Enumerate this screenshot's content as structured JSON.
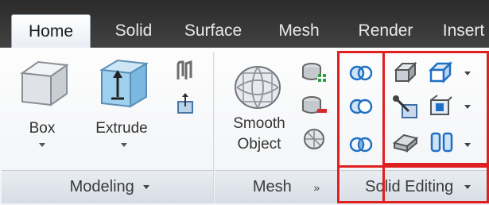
{
  "tabs": [
    {
      "label": "Home",
      "active": true
    },
    {
      "label": "Solid"
    },
    {
      "label": "Surface"
    },
    {
      "label": "Mesh"
    },
    {
      "label": "Render"
    },
    {
      "label": "Insert"
    }
  ],
  "modeling": {
    "box_label": "Box",
    "extrude_label": "Extrude",
    "panel_title": "Modeling"
  },
  "mesh": {
    "smooth_label_line1": "Smooth",
    "smooth_label_line2": "Object",
    "panel_title": "Mesh"
  },
  "solid_editing": {
    "panel_title": "Solid Editing"
  },
  "colors": {
    "highlight": "#e02020",
    "accent_blue": "#1f6fc5",
    "tab_dark": "#333333"
  }
}
